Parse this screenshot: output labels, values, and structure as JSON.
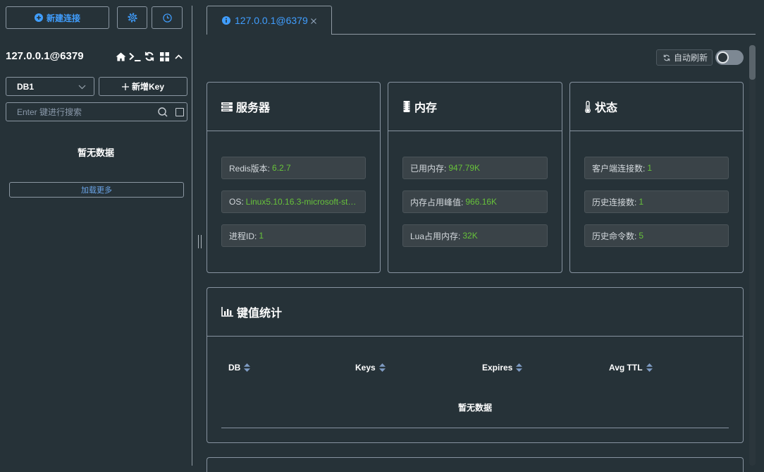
{
  "colors": {
    "background": "#263238",
    "accent": "#409eff",
    "value_green": "#67c23a",
    "border": "#8793a0"
  },
  "sidebar": {
    "new_connection": {
      "label": "新建连接",
      "icon": "plus-circle-icon"
    },
    "settings_button": {
      "icon": "gear-icon"
    },
    "command_log_button": {
      "icon": "clock-icon"
    },
    "connection": {
      "title": "127.0.0.1@6379",
      "actions": [
        {
          "icon": "home-icon"
        },
        {
          "icon": "terminal-icon"
        },
        {
          "icon": "refresh-icon"
        },
        {
          "icon": "grid-icon"
        },
        {
          "icon": "chevron-up-icon"
        }
      ]
    },
    "db_select": {
      "value": "DB1",
      "icon": "chevron-down-icon"
    },
    "new_key": {
      "label": "新增Key",
      "icon": "plus-icon"
    },
    "search": {
      "placeholder": "Enter 键进行搜索",
      "value": ""
    },
    "empty_text": "暂无数据",
    "load_more_label": "加载更多"
  },
  "tabs": [
    {
      "label": "127.0.0.1@6379",
      "icon": "info-icon",
      "active": true,
      "closable": true
    }
  ],
  "toolbar": {
    "auto_refresh": {
      "label": "自动刷新",
      "icon": "refresh-icon",
      "enabled": false
    }
  },
  "cards": {
    "server": {
      "title": "服务器",
      "icon": "server-icon",
      "items": [
        {
          "label": "Redis版本:",
          "value": "6.2.7"
        },
        {
          "label": "OS:",
          "value": "Linux5.10.16.3-microsoft-st…"
        },
        {
          "label": "进程ID:",
          "value": "1"
        }
      ]
    },
    "memory": {
      "title": "内存",
      "icon": "memory-icon",
      "items": [
        {
          "label": "已用内存:",
          "value": "947.79K"
        },
        {
          "label": "内存占用峰值:",
          "value": "966.16K"
        },
        {
          "label": "Lua占用内存:",
          "value": "32K"
        }
      ]
    },
    "status": {
      "title": "状态",
      "icon": "thermometer-icon",
      "items": [
        {
          "label": "客户端连接数:",
          "value": "1"
        },
        {
          "label": "历史连接数:",
          "value": "1"
        },
        {
          "label": "历史命令数:",
          "value": "5"
        }
      ]
    }
  },
  "key_stats": {
    "title": "键值统计",
    "icon": "bar-chart-icon",
    "columns": [
      "DB",
      "Keys",
      "Expires",
      "Avg TTL"
    ],
    "rows": [],
    "empty_text": "暂无数据"
  }
}
